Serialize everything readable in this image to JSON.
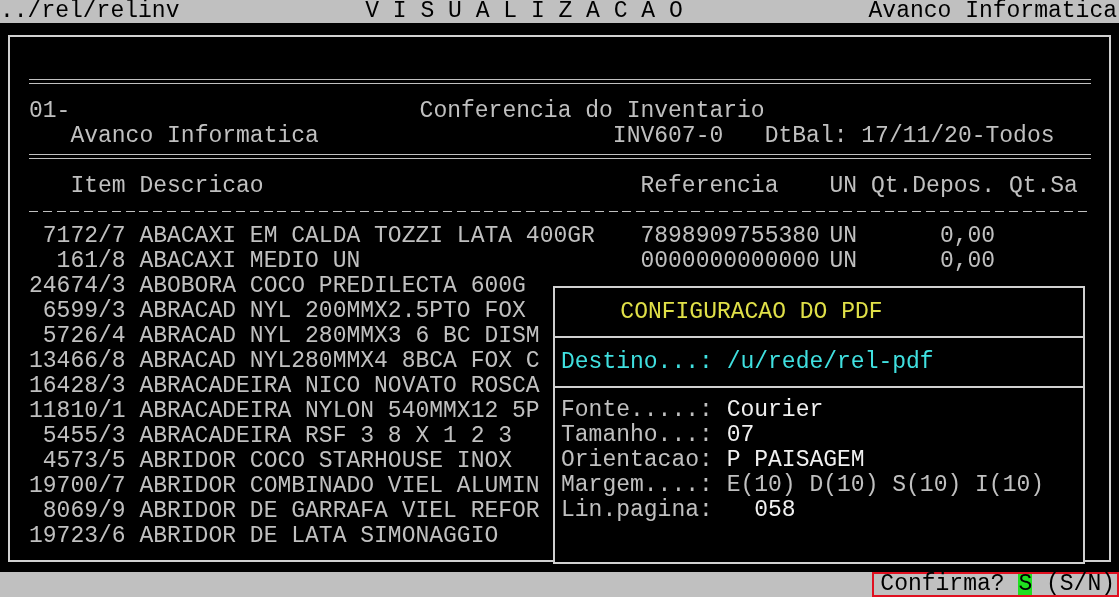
{
  "top_bar": {
    "path": "../rel/relinv",
    "title": "V I S U A L I Z A C A O",
    "company": "Avanco Informatica"
  },
  "report": {
    "header": {
      "code": "01-",
      "title": "Conferencia do Inventario",
      "company": "Avanco Informatica",
      "report_id": "INV607-0",
      "balance_date": "DtBal: 17/11/20-Todos"
    },
    "columns": [
      "Item",
      "Descricao",
      "Referencia",
      "UN",
      "Qt.Depos.",
      "Qt.Sa"
    ],
    "rows": [
      {
        "item": "7172/7",
        "descricao": "ABACAXI EM CALDA TOZZI LATA 400GR",
        "referencia": "7898909755380",
        "un": "UN",
        "qt_depos": "0,00"
      },
      {
        "item": "161/8",
        "descricao": "ABACAXI MEDIO UN",
        "referencia": "0000000000000",
        "un": "UN",
        "qt_depos": "0,00"
      },
      {
        "item": "24674/3",
        "descricao": "ABOBORA COCO PREDILECTA 600G"
      },
      {
        "item": "6599/3",
        "descricao": "ABRACAD NYL 200MMX2.5PTO FOX"
      },
      {
        "item": "5726/4",
        "descricao": "ABRACAD NYL 280MMX3 6 BC DISM"
      },
      {
        "item": "13466/8",
        "descricao": "ABRACAD NYL280MMX4 8BCA FOX C"
      },
      {
        "item": "16428/3",
        "descricao": "ABRACADEIRA NICO NOVATO ROSCA"
      },
      {
        "item": "11810/1",
        "descricao": "ABRACADEIRA NYLON 540MMX12 5P"
      },
      {
        "item": "5455/3",
        "descricao": "ABRACADEIRA RSF 3 8 X 1 2 3"
      },
      {
        "item": "4573/5",
        "descricao": "ABRIDOR COCO STARHOUSE INOX"
      },
      {
        "item": "19700/7",
        "descricao": "ABRIDOR COMBINADO VIEL ALUMIN"
      },
      {
        "item": "8069/9",
        "descricao": "ABRIDOR DE GARRAFA VIEL REFOR"
      },
      {
        "item": "19723/6",
        "descricao": "ABRIDOR DE LATA SIMONAGGIO"
      }
    ]
  },
  "dialog": {
    "title": "CONFIGURACAO DO PDF",
    "destination": {
      "label": "Destino...:",
      "value": "/u/rede/rel-pdf"
    },
    "fields": [
      {
        "label": "Fonte.....:",
        "value": "Courier",
        "kind": "value"
      },
      {
        "label": "Tamanho...:",
        "value": "07",
        "kind": "value"
      },
      {
        "label": "Orientacao:",
        "value": "P PAISAGEM",
        "kind": "value"
      },
      {
        "label": "Margem....:",
        "value": "E(10) D(10) S(10) I(10)",
        "kind": "margins"
      },
      {
        "label": "Lin.pagina:",
        "value": "058",
        "kind": "number"
      }
    ]
  },
  "status_bar": {
    "prompt": "Confirma?",
    "answer": "S",
    "options": "(S/N)"
  }
}
